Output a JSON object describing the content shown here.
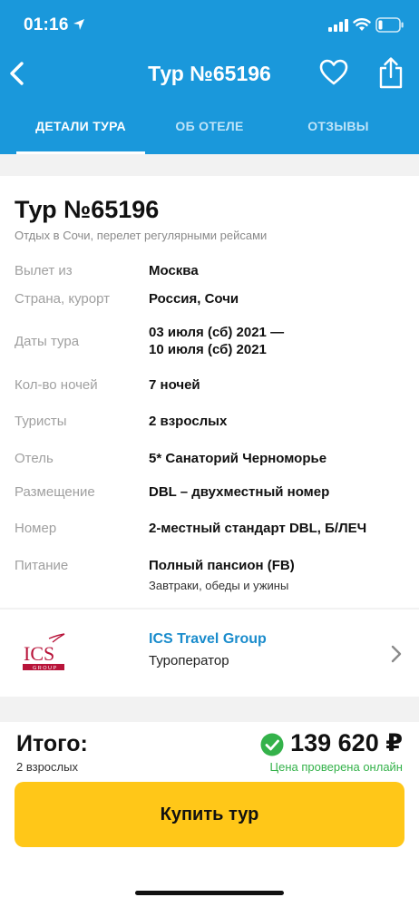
{
  "status_bar": {
    "time": "01:16"
  },
  "nav": {
    "title": "Тур №65196"
  },
  "tabs": [
    {
      "label": "ДЕТАЛИ ТУРА",
      "active": true
    },
    {
      "label": "ОБ ОТЕЛЕ",
      "active": false
    },
    {
      "label": "ОТЗЫВЫ",
      "active": false
    }
  ],
  "tour": {
    "title": "Тур №65196",
    "subtitle": "Отдых в Сочи, перелет регулярными рейсами",
    "rows": [
      {
        "label": "Вылет из",
        "value": "Москва"
      },
      {
        "label": "Страна, курорт",
        "value": "Россия, Сочи"
      },
      {
        "label": "Даты тура",
        "value_line1": "03 июля (сб) 2021 —",
        "value_line2": "10 июля (сб) 2021"
      },
      {
        "label": "Кол-во ночей",
        "value": "7 ночей"
      },
      {
        "label": "Туристы",
        "value": "2 взрослых"
      },
      {
        "label": "Отель",
        "value": "5* Санаторий Черноморье"
      },
      {
        "label": "Размещение",
        "value": "DBL – двухместный номер"
      },
      {
        "label": "Номер",
        "value": "2-местный стандарт DBL, Б/ЛЕЧ"
      },
      {
        "label": "Питание",
        "value": "Полный пансион (FB)",
        "note": "Завтраки, обеды и ужины"
      }
    ]
  },
  "operator": {
    "logo_text": "ICS",
    "logo_subtext": "GROUP",
    "name": "ICS Travel Group",
    "role": "Туроператор"
  },
  "footer": {
    "total_label": "Итого:",
    "tourists": "2 взрослых",
    "price": "139 620 ₽",
    "price_note": "Цена проверена онлайн",
    "buy_label": "Купить тур"
  },
  "colors": {
    "header": "#1a98db",
    "buy_button": "#ffc718",
    "accent_link": "#1a8ccc",
    "verified": "#34b24a",
    "logo_red": "#b8143a"
  }
}
